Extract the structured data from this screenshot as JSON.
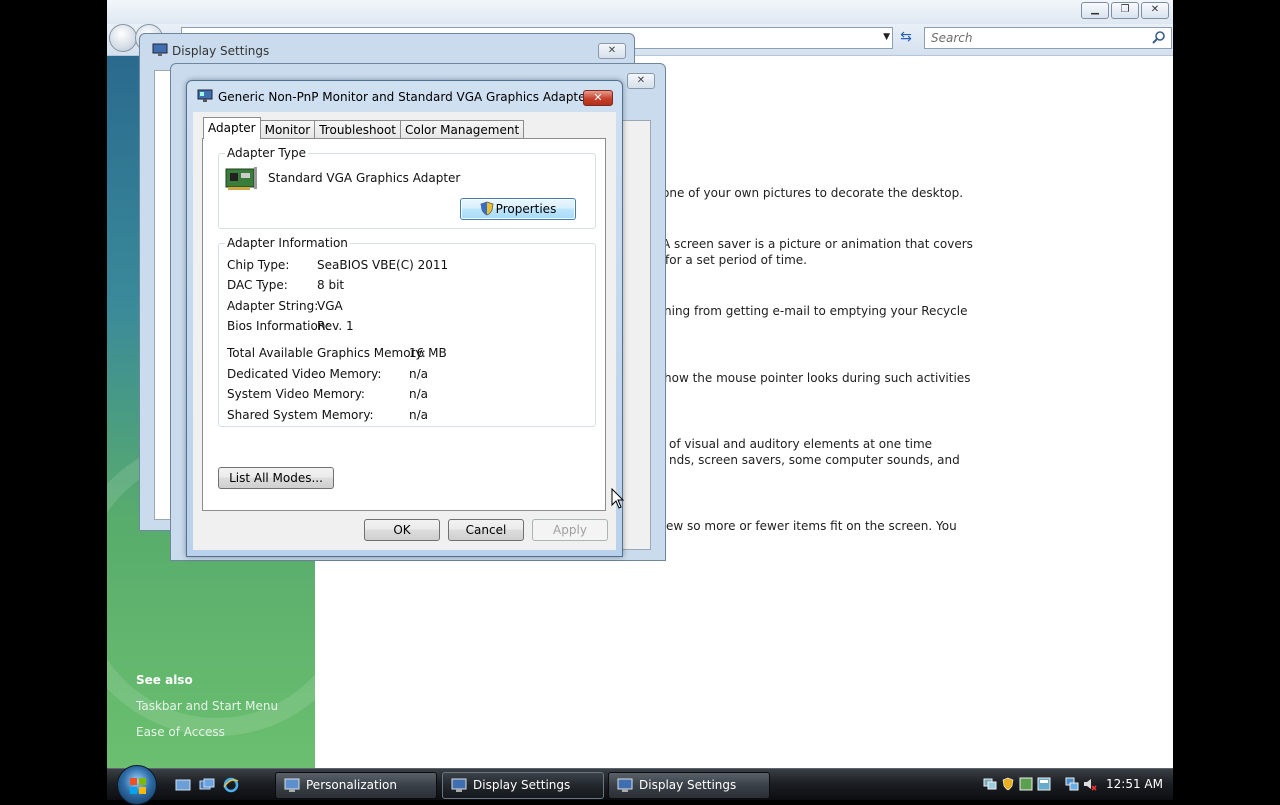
{
  "explorer": {
    "search_placeholder": "Search",
    "see_also_heading": "See also",
    "see_also_links": [
      "Taskbar and Start Menu",
      "Ease of Access"
    ],
    "content_lines": [
      "one of your own pictures to decorate the desktop.",
      "A screen saver is a picture or animation that covers",
      "for a set period of time.",
      "ning from getting e-mail to emptying your Recycle",
      "how the mouse pointer looks during such activities",
      "of visual and auditory elements at one time",
      "nds, screen savers, some computer sounds, and",
      "ew so more or fewer items fit on the screen. You"
    ]
  },
  "back_dialog": {
    "title": "Display Settings"
  },
  "dialog": {
    "title": "Generic Non-PnP Monitor and Standard VGA Graphics Adapter ...",
    "close_label": "✕",
    "tabs": [
      "Adapter",
      "Monitor",
      "Troubleshoot",
      "Color Management"
    ],
    "adapter_type": {
      "group_label": "Adapter Type",
      "name": "Standard VGA Graphics Adapter",
      "properties_label": "Properties"
    },
    "adapter_info": {
      "group_label": "Adapter Information",
      "rows": [
        {
          "label": "Chip Type:",
          "value": "SeaBIOS VBE(C) 2011"
        },
        {
          "label": "DAC Type:",
          "value": "8 bit"
        },
        {
          "label": "Adapter String:",
          "value": "VGA"
        },
        {
          "label": "Bios Information:",
          "value": "Rev. 1"
        }
      ],
      "memory_rows": [
        {
          "label": "Total Available Graphics Memory:",
          "value": "16 MB"
        },
        {
          "label": "Dedicated Video Memory:",
          "value": "n/a"
        },
        {
          "label": "System Video Memory:",
          "value": "n/a"
        },
        {
          "label": "Shared System Memory:",
          "value": "n/a"
        }
      ]
    },
    "list_modes_label": "List All Modes...",
    "ok_label": "OK",
    "cancel_label": "Cancel",
    "apply_label": "Apply"
  },
  "taskbar": {
    "tasks": [
      "Personalization",
      "Display Settings",
      "Display Settings"
    ],
    "clock": "12:51 AM"
  }
}
